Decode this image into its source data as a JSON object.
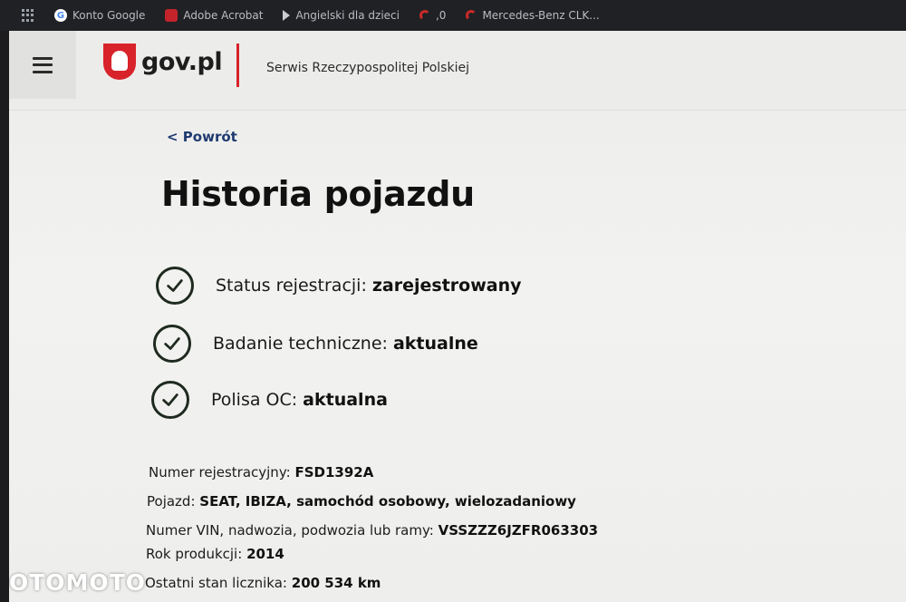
{
  "bookmarks": [
    {
      "label": "Konto Google",
      "icon": "google-icon"
    },
    {
      "label": "Adobe Acrobat",
      "icon": "acrobat-icon"
    },
    {
      "label": "Angielski dla dzieci",
      "icon": "arrow-icon"
    },
    {
      "label": ",0",
      "icon": "arc-icon"
    },
    {
      "label": "Mercedes-Benz CLK...",
      "icon": "arc-icon"
    }
  ],
  "header": {
    "logo_text": "gov.pl",
    "service_name": "Serwis Rzeczypospolitej Polskiej"
  },
  "back_link": "< Powrót",
  "title": "Historia pojazdu",
  "status_items": [
    {
      "label": "Status rejestracji:",
      "value": "zarejestrowany"
    },
    {
      "label": "Badanie techniczne:",
      "value": "aktualne"
    },
    {
      "label": "Polisa OC:",
      "value": "aktualna"
    }
  ],
  "details": [
    {
      "label": "Numer rejestracyjny:",
      "value": "FSD1392A"
    },
    {
      "label": "Pojazd:",
      "value": "SEAT, IBIZA, samochód osobowy, wielozadaniowy"
    },
    {
      "label": "Numer VIN, nadwozia, podwozia lub ramy:",
      "value": "VSSZZZ6JZFR063303"
    },
    {
      "label": "Rok produkcji:",
      "value": "2014"
    },
    {
      "label": "Ostatni stan licznika:",
      "value": "200 534 km"
    }
  ],
  "watermark": "OTOMOTO",
  "colors": {
    "accent_red": "#d8232a",
    "link_blue": "#1f3a70"
  }
}
